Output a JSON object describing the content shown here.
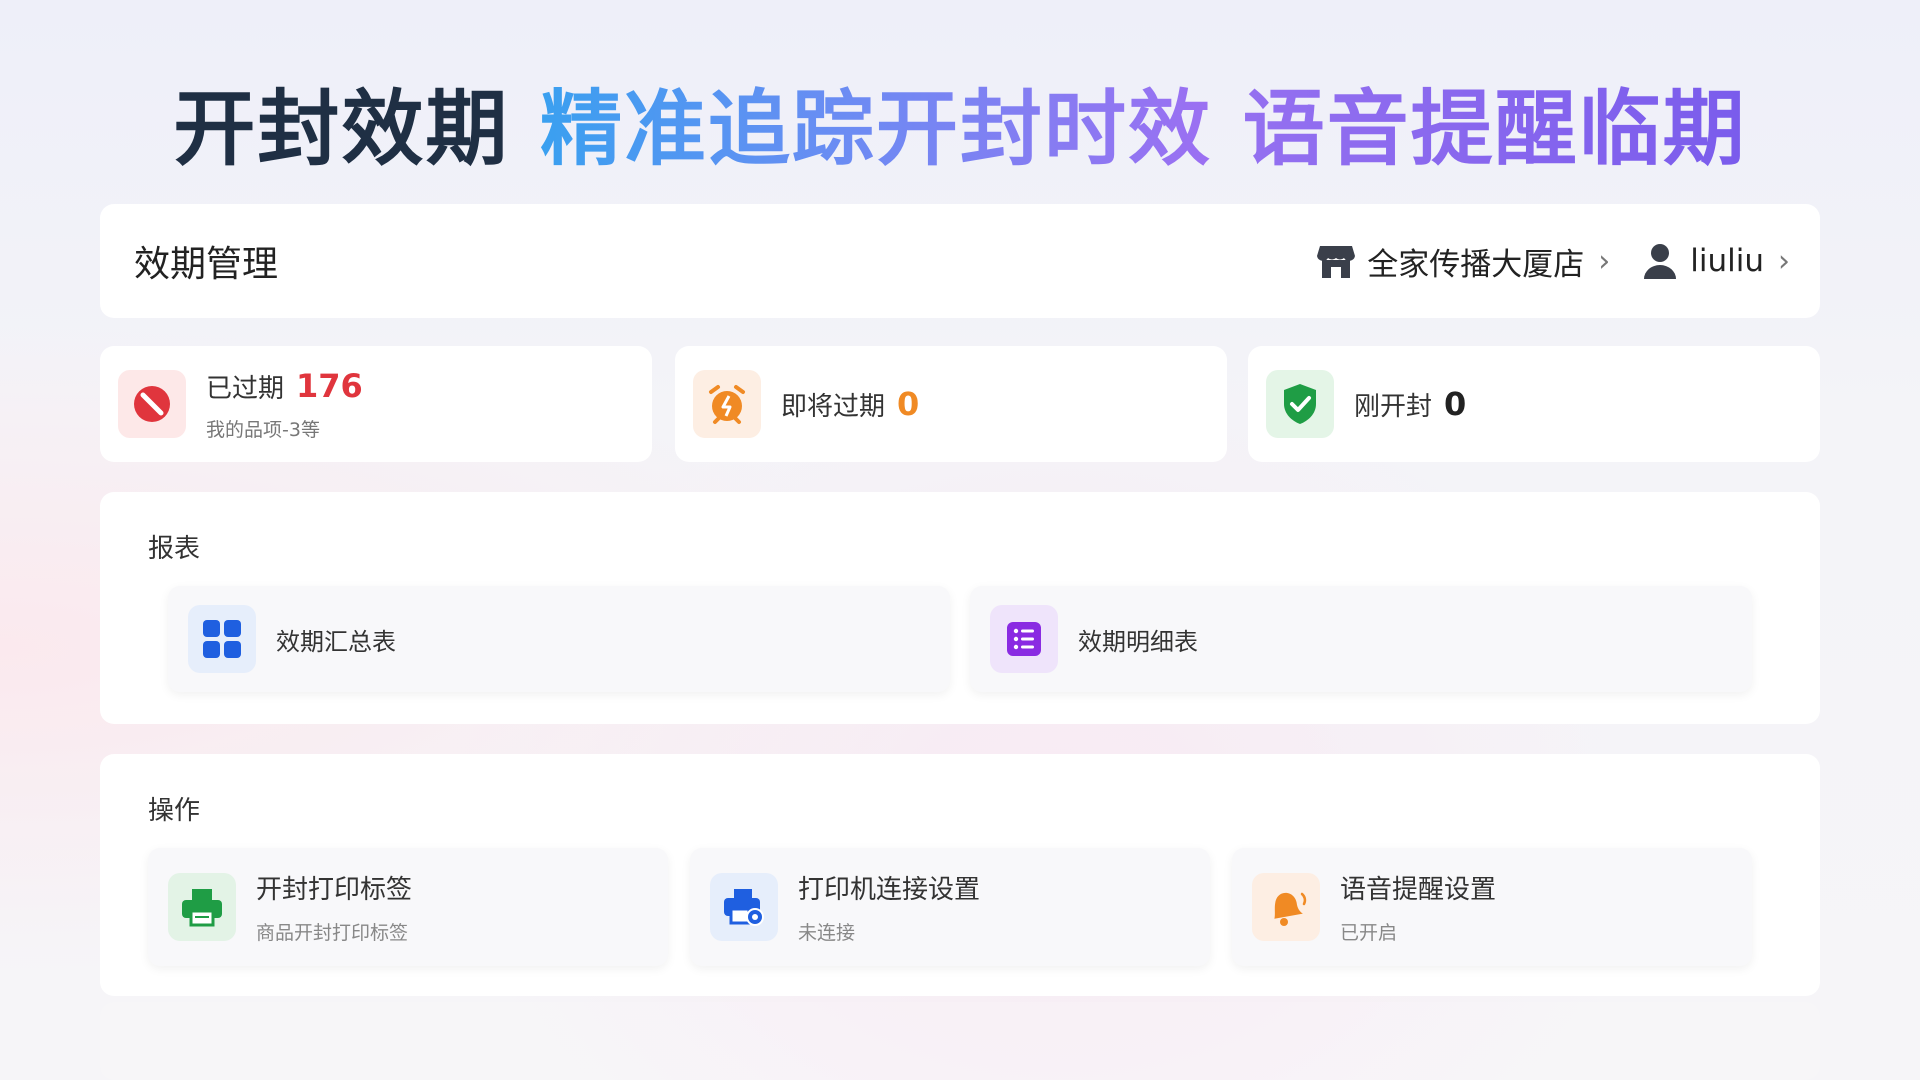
{
  "hero": {
    "part1": "开封效期",
    "part2": "精准追踪开封时效",
    "part3": "语音提醒临期"
  },
  "header": {
    "title": "效期管理",
    "store_name": "全家传播大厦店",
    "user_name": "liuliu"
  },
  "stats": [
    {
      "label": "已过期",
      "value": "176",
      "sub": "我的品项-3等",
      "color": "#e0353d",
      "icon": "ban-icon"
    },
    {
      "label": "即将过期",
      "value": "0",
      "color": "#f08a24",
      "icon": "alarm-clock-icon"
    },
    {
      "label": "刚开封",
      "value": "0",
      "color": "#222222",
      "icon": "shield-check-icon"
    }
  ],
  "reports": {
    "label": "报表",
    "items": [
      {
        "name": "效期汇总表",
        "icon": "grid-icon"
      },
      {
        "name": "效期明细表",
        "icon": "list-icon"
      }
    ]
  },
  "operations": {
    "label": "操作",
    "items": [
      {
        "name": "开封打印标签",
        "sub": "商品开封打印标签",
        "icon": "printer-icon"
      },
      {
        "name": "打印机连接设置",
        "sub": "未连接",
        "icon": "printer-settings-icon"
      },
      {
        "name": "语音提醒设置",
        "sub": "已开启",
        "icon": "bell-icon"
      }
    ]
  }
}
